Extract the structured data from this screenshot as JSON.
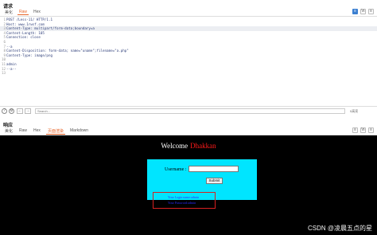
{
  "request": {
    "title": "请求",
    "tabs": [
      "美化",
      "Raw",
      "Hex"
    ],
    "active_tab": "Raw",
    "lines": [
      {
        "n": "1",
        "t": "POST /Less-11/ HTTP/1.1"
      },
      {
        "n": "2",
        "t": "Host: www.1rwsf.com"
      },
      {
        "n": "3",
        "t": "Content-Type: multipart/form-data;boundary=a"
      },
      {
        "n": "4",
        "t": "Content-Length: 105"
      },
      {
        "n": "5",
        "t": "Connection: close"
      },
      {
        "n": "6",
        "t": ""
      },
      {
        "n": "7",
        "t": "--a"
      },
      {
        "n": "8",
        "t": "Content-Disposition: form-data; name=\"uname\";filename=\"a.php\""
      },
      {
        "n": "9",
        "t": "Content-Type: image/png"
      },
      {
        "n": "10",
        "t": ""
      },
      {
        "n": "11",
        "t": "admin"
      },
      {
        "n": "12",
        "t": "--a--"
      },
      {
        "n": "13",
        "t": ""
      }
    ],
    "highlight_line": "3"
  },
  "search": {
    "placeholder": "Search...",
    "match_count": "0高亮"
  },
  "response": {
    "title": "响应",
    "tabs": [
      "美化",
      "Raw",
      "Hex",
      "页面渲染",
      "Markdown"
    ],
    "active_tab": "页面渲染"
  },
  "page": {
    "welcome_prefix": "Welcome",
    "welcome_name": "Dhakkan",
    "username_label": "Username :",
    "submit_label": "Submit",
    "links": [
      "Your Login name:admin",
      "Your Password:admin"
    ]
  },
  "watermark": "CSDN @凌晨五点的星",
  "colors": {
    "accent": "#e8652a",
    "page_bg": "#000000",
    "form_bg": "#00e5ff",
    "name_red": "#ff1a1a",
    "box_red": "#d62020",
    "link_blue": "#2a2aff"
  }
}
